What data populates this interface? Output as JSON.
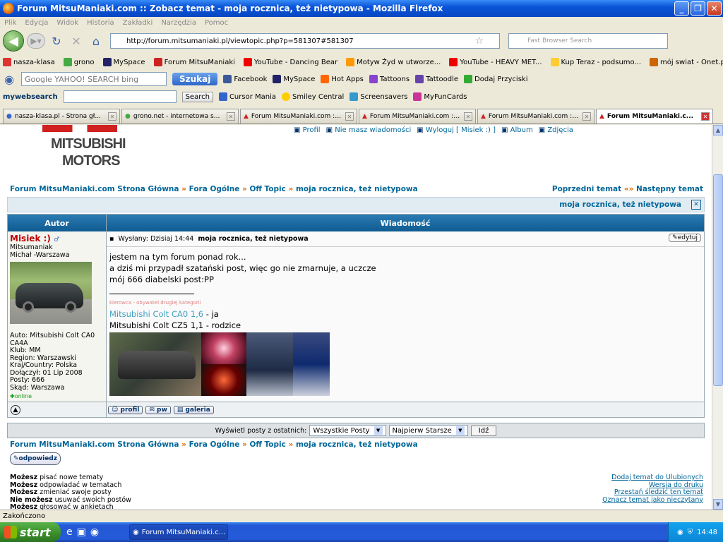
{
  "window": {
    "title": "Forum MitsuManiaki.com :: Zobacz temat - moja rocznica, też nietypowa - Mozilla Firefox"
  },
  "menu": [
    "Plik",
    "Edycja",
    "Widok",
    "Historia",
    "Zakładki",
    "Narzędzia",
    "Pomoc"
  ],
  "nav": {
    "url": "http://forum.mitsumaniaki.pl/viewtopic.php?p=581307#581307",
    "search_placeholder": "Fast Browser Search"
  },
  "bookmarks": [
    "nasza-klasa",
    "grono",
    "MySpace",
    "Forum MitsuManiaki",
    "YouTube - Dancing Bear",
    "Motyw Żyd w utworze...",
    "YouTube - HEAVY MET...",
    "Kup Teraz - podsumo...",
    "mój swiat - Onet.pl Blog"
  ],
  "toolbar2": {
    "engines": "Google YAHOO! SEARCH bing",
    "szukaj": "Szukaj",
    "items": [
      "Facebook",
      "MySpace",
      "Hot Apps",
      "Tattoons",
      "Tattoodle",
      "Dodaj Przyciski"
    ]
  },
  "toolbar3": {
    "brand": "mywebsearch",
    "search_btn": "Search",
    "items": [
      "Cursor Mania",
      "Smiley Central",
      "Screensavers",
      "MyFunCards"
    ]
  },
  "tabs": [
    "nasza-klasa.pl - Strona gł...",
    "grono.net - internetowa s...",
    "Forum MitsuManiaki.com ::...",
    "Forum MitsuManiaki.com ::...",
    "Forum MitsuManiaki.com ::...",
    "Forum MitsuManiaki.c..."
  ],
  "logo": {
    "line1": "MITSUBISHI",
    "line2": "MOTORS"
  },
  "toplinks": [
    "Profil",
    "Nie masz wiadomości",
    "Wyloguj [ Misiek :) ]",
    "Album",
    "Zdjęcia"
  ],
  "breadcrumb": [
    "Forum MitsuManiaki.com Strona Główna",
    "Fora Ogólne",
    "Off Topic",
    "moja rocznica, też nietypowa"
  ],
  "prevnext": {
    "prev": "Poprzedni temat",
    "sep": "«»",
    "next": "Następny temat"
  },
  "topic_title": "moja rocznica, też nietypowa",
  "table": {
    "col_author": "Autor",
    "col_message": "Wiadomość"
  },
  "author": {
    "name": "Misiek :)",
    "rank": "Mitsumaniak",
    "real": "Michał -Warszawa",
    "profile": [
      "Auto: Mitsubishi Colt CA0 CA4A",
      "Klub: MM",
      "Region: Warszawski",
      "Kraj/Country: Polska",
      "Dołączył: 01 Lip 2008",
      "Posty: 666",
      "Skąd: Warszawa"
    ],
    "online": "online"
  },
  "post": {
    "posted": "Wysłany: Dzisiaj 14:44",
    "subject": "moja rocznica, też nietypowa",
    "edit": "edytuj",
    "lines": [
      "jestem na tym forum ponad rok...",
      "a dziś mi przypadł szatański post, więc go nie zmarnuje, a uczcze",
      "mój 666 diabelski post:PP"
    ],
    "sig_small": "kierowca - obywatel drugiej kategorii",
    "sig_link": "Mitsubishi Colt CA0 1,6",
    "sig_link_suffix": " - ja",
    "sig_line2": "Mitsubishi Colt CZ5 1,1 - rodzice"
  },
  "post_buttons": [
    "profil",
    "pw",
    "galeria"
  ],
  "display": {
    "label": "Wyświetl posty z ostatnich:",
    "sel1": "Wszystkie Posty",
    "sel2": "Najpierw Starsze",
    "go": "Idź"
  },
  "reply": "odpowiedz",
  "perms": [
    {
      "b": "Możesz",
      "t": " pisać nowe tematy"
    },
    {
      "b": "Możesz",
      "t": " odpowiadać w tematach"
    },
    {
      "b": "Możesz",
      "t": " zmieniać swoje posty"
    },
    {
      "b": "Nie możesz",
      "t": " usuwać swoich postów"
    },
    {
      "b": "Możesz",
      "t": " głosować w ankietach"
    }
  ],
  "rightlinks": [
    "Dodaj temat do Ulubionych",
    "Wersja do druku",
    "Przestań śledzić ten temat",
    "Oznacz temat jako nieczytany"
  ],
  "status": "Zakończono",
  "taskbar": {
    "start": "start",
    "task": "Forum MitsuManiaki.c...",
    "clock": "14:48"
  }
}
